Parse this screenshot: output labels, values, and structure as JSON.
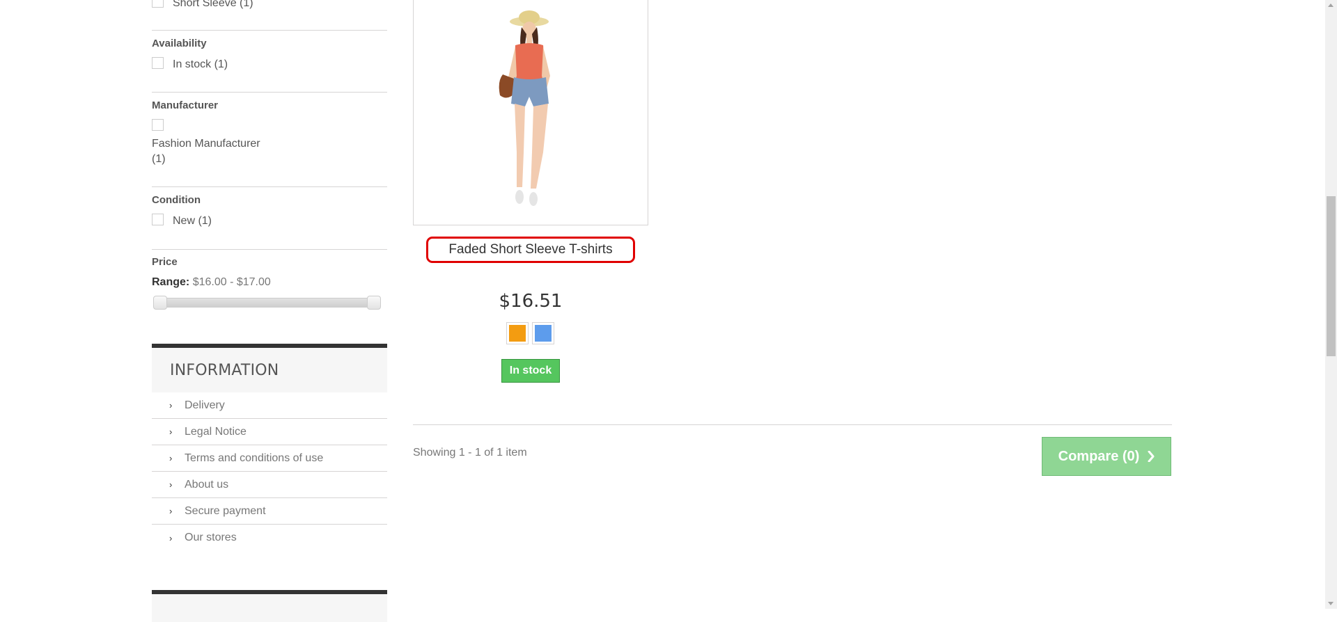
{
  "filters": {
    "style_item": "Short Sleeve (1)",
    "availability": {
      "title": "Availability",
      "option": "In stock (1)"
    },
    "manufacturer": {
      "title": "Manufacturer",
      "option_line1": "Fashion Manufacturer",
      "option_line2": "(1)"
    },
    "condition": {
      "title": "Condition",
      "option": "New (1)"
    },
    "price": {
      "title": "Price",
      "range_label": "Range:",
      "range_value": "$16.00 - $17.00"
    }
  },
  "information": {
    "title": "INFORMATION",
    "items": [
      "Delivery",
      "Legal Notice",
      "Terms and conditions of use",
      "About us",
      "Secure payment",
      "Our stores"
    ]
  },
  "product": {
    "name": "Faded Short Sleeve T-shirts",
    "price": "$16.51",
    "colors": [
      "#f39c11",
      "#5d9cec"
    ],
    "stock_label": "In stock",
    "image_icon": "model-in-orange-top-and-denim-shorts"
  },
  "listing": {
    "showing": "Showing 1 - 1 of 1 item",
    "compare_label": "Compare (0)"
  }
}
